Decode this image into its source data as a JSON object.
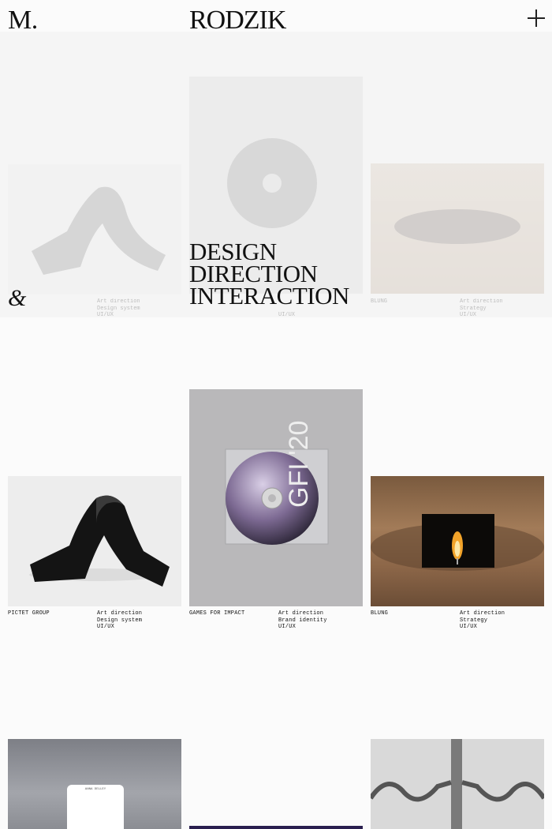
{
  "header": {
    "logo": "M.",
    "name": "RODZIK",
    "menu_icon": "plus-icon"
  },
  "intro": {
    "tagline": [
      "DESIGN",
      "DIRECTION",
      "INTERACTION"
    ],
    "ampersand": "&"
  },
  "projects": [
    {
      "client": "PICTET GROUP",
      "roles": [
        "Art direction",
        "Design system",
        "UI/UX"
      ]
    },
    {
      "client": "GAMES FOR IMPACT",
      "roles": [
        "Art direction",
        "Brand identity",
        "UI/UX"
      ]
    },
    {
      "client": "BLUNG",
      "roles": [
        "Art direction",
        "Strategy",
        "UI/UX"
      ]
    }
  ],
  "cd_label": "GFI '20",
  "phone_label": "ANNA DELLEY",
  "colors": {
    "background": "#fbfbfb",
    "ink": "#111111",
    "cd_bg": "#b9b8ba",
    "accent_strip": "#2a1f4f"
  }
}
